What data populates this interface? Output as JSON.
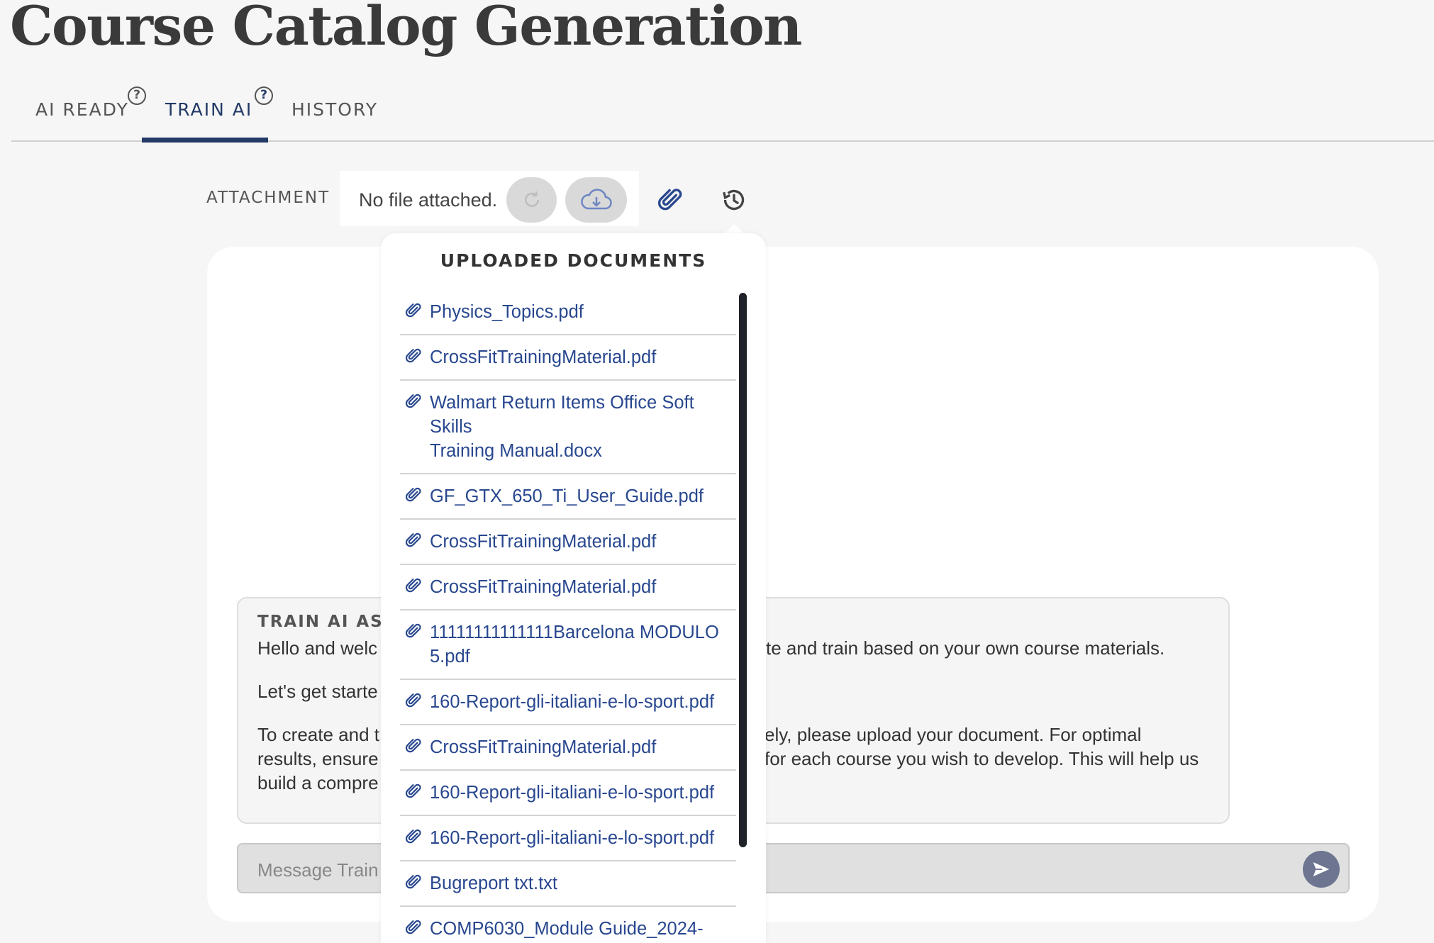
{
  "page": {
    "title": "Course Catalog Generation"
  },
  "tabs": [
    {
      "label": "AI READY",
      "help": "?"
    },
    {
      "label": "TRAIN AI",
      "help": "?"
    },
    {
      "label": "HISTORY"
    }
  ],
  "attachment": {
    "label": "ATTACHMENT",
    "status": "No file attached."
  },
  "uploaded_documents": {
    "title": "UPLOADED DOCUMENTS",
    "items": [
      {
        "lines": [
          "Physics_Topics.pdf"
        ]
      },
      {
        "lines": [
          "CrossFitTrainingMaterial.pdf"
        ]
      },
      {
        "lines": [
          "Walmart Return Items Office Soft Skills",
          "Training Manual.docx"
        ]
      },
      {
        "lines": [
          "GF_GTX_650_Ti_User_Guide.pdf"
        ]
      },
      {
        "lines": [
          "CrossFitTrainingMaterial.pdf"
        ]
      },
      {
        "lines": [
          "CrossFitTrainingMaterial.pdf"
        ]
      },
      {
        "lines": [
          "11111111111111Barcelona MODULO",
          "5.pdf"
        ]
      },
      {
        "lines": [
          "160-Report-gli-italiani-e-lo-sport.pdf"
        ]
      },
      {
        "lines": [
          "CrossFitTrainingMaterial.pdf"
        ]
      },
      {
        "lines": [
          "160-Report-gli-italiani-e-lo-sport.pdf"
        ]
      },
      {
        "lines": [
          "160-Report-gli-italiani-e-lo-sport.pdf"
        ]
      },
      {
        "lines": [
          "Bugreport txt.txt"
        ]
      },
      {
        "lines": [
          "COMP6030_Module Guide_2024-"
        ]
      }
    ]
  },
  "assistant": {
    "title": "TRAIN AI ASSIS",
    "line1_left": "Hello and welc",
    "line1_right": "te and train based on your own course materials.",
    "line2_left": "Let's get starte",
    "line3_left": "To create and t",
    "line3_right": "ely, please upload your document. For optimal",
    "line4_left": "results, ensure",
    "line4_right": "for each course you wish to develop. This will help us",
    "line5_left": "build a compre"
  },
  "message": {
    "placeholder": "Message Train A"
  },
  "colors": {
    "accent": "#233a66",
    "link": "#28478f",
    "send": "#6d7590"
  }
}
